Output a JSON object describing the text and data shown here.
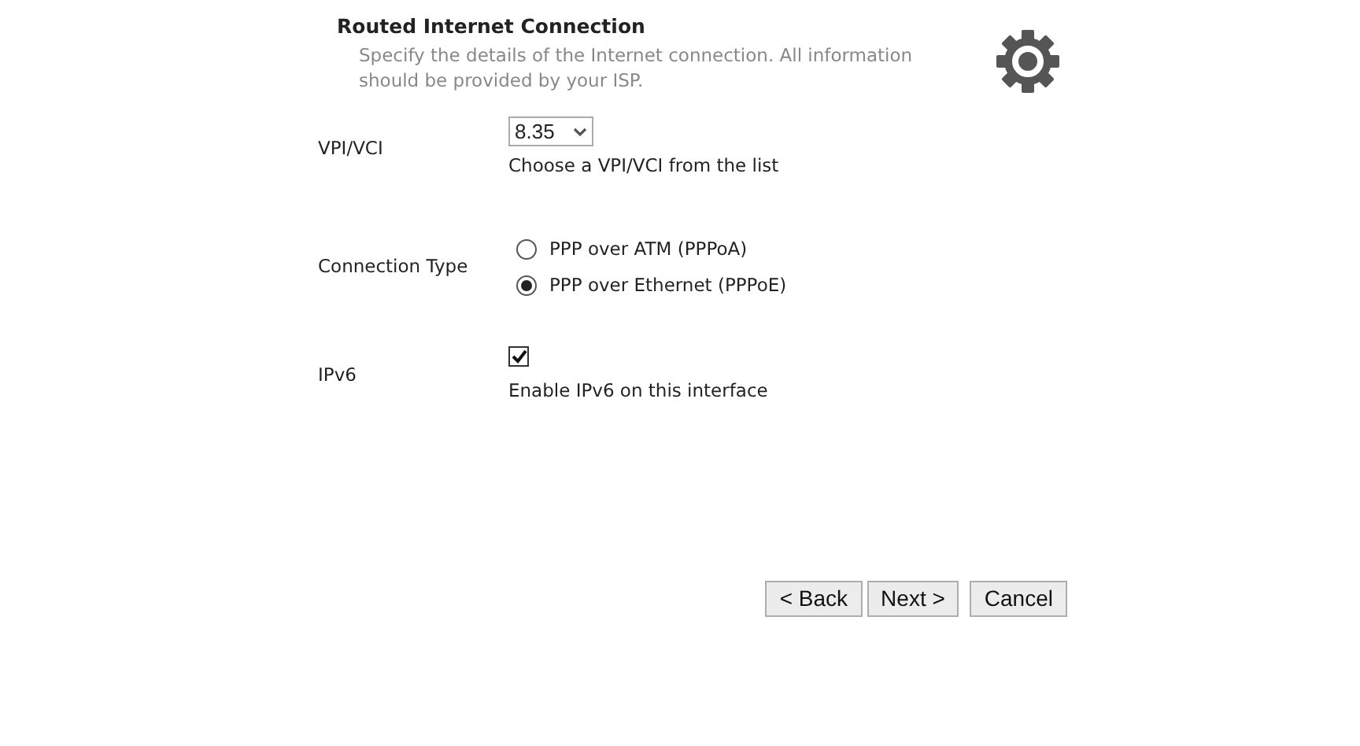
{
  "header": {
    "title": "Routed Internet Connection",
    "description": "Specify the details of the Internet connection. All information should be provided by your ISP."
  },
  "vpi_vci": {
    "label": "VPI/VCI",
    "value": "8.35",
    "hint": "Choose a VPI/VCI from the list"
  },
  "connection_type": {
    "label": "Connection Type",
    "options": [
      {
        "label": "PPP over ATM (PPPoA)",
        "selected": false
      },
      {
        "label": "PPP over Ethernet (PPPoE)",
        "selected": true
      }
    ]
  },
  "ipv6": {
    "label": "IPv6",
    "checked": true,
    "hint": "Enable IPv6 on this interface"
  },
  "buttons": [
    "< Back",
    "Next >",
    "Cancel"
  ]
}
